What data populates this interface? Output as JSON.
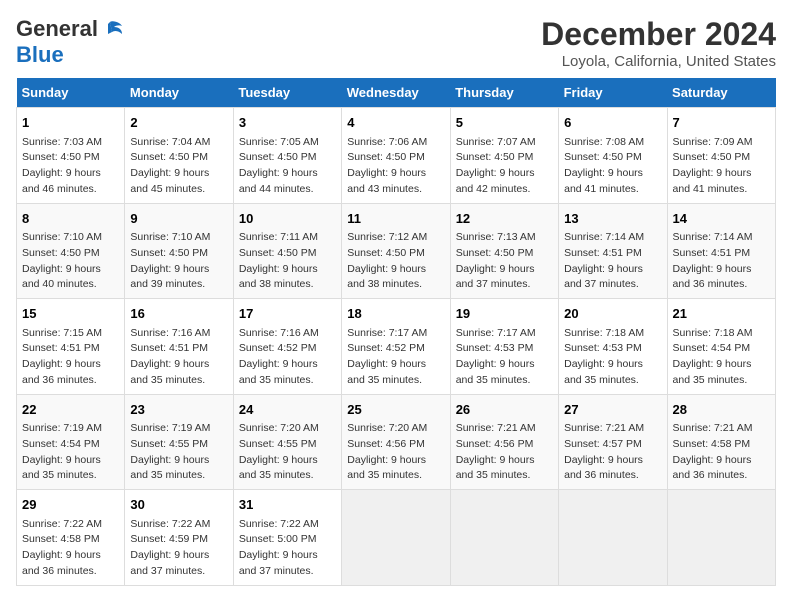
{
  "logo": {
    "general": "General",
    "blue": "Blue"
  },
  "title": "December 2024",
  "subtitle": "Loyola, California, United States",
  "days_header": [
    "Sunday",
    "Monday",
    "Tuesday",
    "Wednesday",
    "Thursday",
    "Friday",
    "Saturday"
  ],
  "weeks": [
    [
      {
        "day": "1",
        "info": "Sunrise: 7:03 AM\nSunset: 4:50 PM\nDaylight: 9 hours\nand 46 minutes."
      },
      {
        "day": "2",
        "info": "Sunrise: 7:04 AM\nSunset: 4:50 PM\nDaylight: 9 hours\nand 45 minutes."
      },
      {
        "day": "3",
        "info": "Sunrise: 7:05 AM\nSunset: 4:50 PM\nDaylight: 9 hours\nand 44 minutes."
      },
      {
        "day": "4",
        "info": "Sunrise: 7:06 AM\nSunset: 4:50 PM\nDaylight: 9 hours\nand 43 minutes."
      },
      {
        "day": "5",
        "info": "Sunrise: 7:07 AM\nSunset: 4:50 PM\nDaylight: 9 hours\nand 42 minutes."
      },
      {
        "day": "6",
        "info": "Sunrise: 7:08 AM\nSunset: 4:50 PM\nDaylight: 9 hours\nand 41 minutes."
      },
      {
        "day": "7",
        "info": "Sunrise: 7:09 AM\nSunset: 4:50 PM\nDaylight: 9 hours\nand 41 minutes."
      }
    ],
    [
      {
        "day": "8",
        "info": "Sunrise: 7:10 AM\nSunset: 4:50 PM\nDaylight: 9 hours\nand 40 minutes."
      },
      {
        "day": "9",
        "info": "Sunrise: 7:10 AM\nSunset: 4:50 PM\nDaylight: 9 hours\nand 39 minutes."
      },
      {
        "day": "10",
        "info": "Sunrise: 7:11 AM\nSunset: 4:50 PM\nDaylight: 9 hours\nand 38 minutes."
      },
      {
        "day": "11",
        "info": "Sunrise: 7:12 AM\nSunset: 4:50 PM\nDaylight: 9 hours\nand 38 minutes."
      },
      {
        "day": "12",
        "info": "Sunrise: 7:13 AM\nSunset: 4:50 PM\nDaylight: 9 hours\nand 37 minutes."
      },
      {
        "day": "13",
        "info": "Sunrise: 7:14 AM\nSunset: 4:51 PM\nDaylight: 9 hours\nand 37 minutes."
      },
      {
        "day": "14",
        "info": "Sunrise: 7:14 AM\nSunset: 4:51 PM\nDaylight: 9 hours\nand 36 minutes."
      }
    ],
    [
      {
        "day": "15",
        "info": "Sunrise: 7:15 AM\nSunset: 4:51 PM\nDaylight: 9 hours\nand 36 minutes."
      },
      {
        "day": "16",
        "info": "Sunrise: 7:16 AM\nSunset: 4:51 PM\nDaylight: 9 hours\nand 35 minutes."
      },
      {
        "day": "17",
        "info": "Sunrise: 7:16 AM\nSunset: 4:52 PM\nDaylight: 9 hours\nand 35 minutes."
      },
      {
        "day": "18",
        "info": "Sunrise: 7:17 AM\nSunset: 4:52 PM\nDaylight: 9 hours\nand 35 minutes."
      },
      {
        "day": "19",
        "info": "Sunrise: 7:17 AM\nSunset: 4:53 PM\nDaylight: 9 hours\nand 35 minutes."
      },
      {
        "day": "20",
        "info": "Sunrise: 7:18 AM\nSunset: 4:53 PM\nDaylight: 9 hours\nand 35 minutes."
      },
      {
        "day": "21",
        "info": "Sunrise: 7:18 AM\nSunset: 4:54 PM\nDaylight: 9 hours\nand 35 minutes."
      }
    ],
    [
      {
        "day": "22",
        "info": "Sunrise: 7:19 AM\nSunset: 4:54 PM\nDaylight: 9 hours\nand 35 minutes."
      },
      {
        "day": "23",
        "info": "Sunrise: 7:19 AM\nSunset: 4:55 PM\nDaylight: 9 hours\nand 35 minutes."
      },
      {
        "day": "24",
        "info": "Sunrise: 7:20 AM\nSunset: 4:55 PM\nDaylight: 9 hours\nand 35 minutes."
      },
      {
        "day": "25",
        "info": "Sunrise: 7:20 AM\nSunset: 4:56 PM\nDaylight: 9 hours\nand 35 minutes."
      },
      {
        "day": "26",
        "info": "Sunrise: 7:21 AM\nSunset: 4:56 PM\nDaylight: 9 hours\nand 35 minutes."
      },
      {
        "day": "27",
        "info": "Sunrise: 7:21 AM\nSunset: 4:57 PM\nDaylight: 9 hours\nand 36 minutes."
      },
      {
        "day": "28",
        "info": "Sunrise: 7:21 AM\nSunset: 4:58 PM\nDaylight: 9 hours\nand 36 minutes."
      }
    ],
    [
      {
        "day": "29",
        "info": "Sunrise: 7:22 AM\nSunset: 4:58 PM\nDaylight: 9 hours\nand 36 minutes."
      },
      {
        "day": "30",
        "info": "Sunrise: 7:22 AM\nSunset: 4:59 PM\nDaylight: 9 hours\nand 37 minutes."
      },
      {
        "day": "31",
        "info": "Sunrise: 7:22 AM\nSunset: 5:00 PM\nDaylight: 9 hours\nand 37 minutes."
      },
      null,
      null,
      null,
      null
    ]
  ]
}
